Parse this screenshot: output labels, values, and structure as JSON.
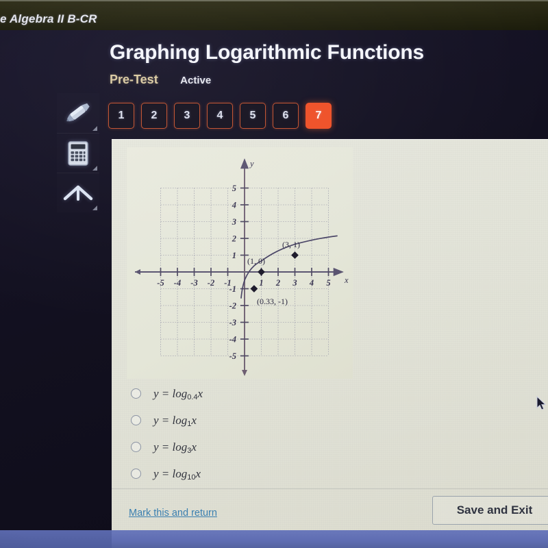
{
  "browser": {
    "tab_title": "e Algebra II B-CR"
  },
  "header": {
    "title": "Graphing Logarithmic Functions",
    "pretest_label": "Pre-Test",
    "status_label": "Active"
  },
  "question_nav": {
    "items": [
      "1",
      "2",
      "3",
      "4",
      "5",
      "6",
      "7"
    ],
    "current": "7",
    "current_color": "#ef4f26",
    "outline_color": "#c2502d"
  },
  "toolbar": {
    "items": [
      {
        "name": "highlighter-icon",
        "label": "Highlighter"
      },
      {
        "name": "calculator-icon",
        "label": "Calculator"
      },
      {
        "name": "chevron-up-icon",
        "label": "Reference"
      }
    ]
  },
  "chart_data": {
    "type": "line",
    "title": "",
    "xlabel": "x",
    "ylabel": "y",
    "xlim": [
      -5.6,
      5.6
    ],
    "ylim": [
      -5.6,
      5.6
    ],
    "xticks": [
      -5,
      -4,
      -3,
      -2,
      -1,
      1,
      2,
      3,
      4,
      5
    ],
    "yticks": [
      -5,
      -4,
      -3,
      -2,
      -1,
      1,
      2,
      3,
      4,
      5
    ],
    "xtick_labels": [
      "-5",
      "-4",
      "-3",
      "-2",
      "-1",
      "1",
      "2",
      "3",
      "4",
      "5"
    ],
    "ytick_labels": [
      "-5",
      "-4",
      "-3",
      "-2",
      "-1",
      "1",
      "2",
      "3",
      "4",
      "5"
    ],
    "grid": true,
    "legend": "none",
    "function": "y = log base 3 of x",
    "curve_color": "#4a4566",
    "points": [
      {
        "x": 0.33,
        "y": -1,
        "label": "(0.33, -1)"
      },
      {
        "x": 1,
        "y": 0,
        "label": "(1, 0)"
      },
      {
        "x": 3,
        "y": 1,
        "label": "(3, 1)"
      }
    ],
    "series": [
      {
        "name": "y = log_3 x",
        "x": [
          0.19,
          0.23,
          0.28,
          0.33,
          0.42,
          0.55,
          0.72,
          1.0,
          1.4,
          1.9,
          2.4,
          3.0,
          3.6,
          4.3,
          5.0,
          5.6
        ],
        "y": [
          -1.51,
          -1.34,
          -1.16,
          -1.01,
          -0.79,
          -0.54,
          -0.3,
          0.0,
          0.31,
          0.58,
          0.8,
          1.0,
          1.17,
          1.33,
          1.46,
          1.57
        ]
      }
    ]
  },
  "options": [
    {
      "id": "a",
      "prefix": "y = log",
      "base": "0.4",
      "arg": "x",
      "selected": false
    },
    {
      "id": "b",
      "prefix": "y = log",
      "base": "1",
      "arg": "x",
      "selected": false
    },
    {
      "id": "c",
      "prefix": "y = log",
      "base": "3",
      "arg": "x",
      "selected": false
    },
    {
      "id": "d",
      "prefix": "y = log",
      "base": "10",
      "arg": "x",
      "selected": false
    }
  ],
  "footer": {
    "mark_link": "Mark this and return",
    "save_exit": "Save and Exit",
    "link_color": "#3a7fb0"
  }
}
